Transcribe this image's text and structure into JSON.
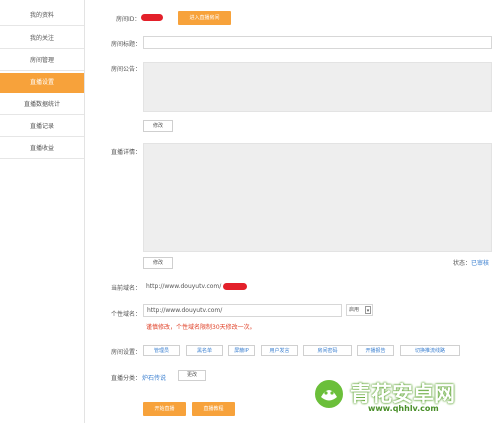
{
  "sidebar": {
    "items": [
      {
        "label": "我的资料"
      },
      {
        "label": "我的关注"
      },
      {
        "label": "房间管理"
      },
      {
        "label": "直播设置",
        "active": true
      },
      {
        "label": "直播数据统计"
      },
      {
        "label": "直播记录"
      },
      {
        "label": "直播收益"
      }
    ]
  },
  "form": {
    "room_id_label": "房间ID：",
    "enter_room_button": "进入直播房间",
    "room_title_label": "房间标题：",
    "room_title_value": "",
    "announcement_label": "房间公告：",
    "announcement_edit": "修改",
    "details_label": "直播详情：",
    "details_edit": "修改",
    "status_label": "状态：",
    "status_value": "已审核",
    "current_domain_label": "当前域名：",
    "current_domain_value": "http://www.douyutv.com/",
    "custom_domain_label": "个性域名：",
    "custom_domain_prefix": "http://www.douyutv.com/",
    "custom_domain_select": "启用",
    "custom_domain_notice": "谨慎修改，个性域名限制30天修改一次。",
    "room_settings_label": "房间设置：",
    "settings_buttons": [
      "管理员",
      "黑名单",
      "屏蔽IP",
      "用户发言",
      "房间密码",
      "开播报告",
      "切换推流线路"
    ],
    "category_label": "直播分类：",
    "category_value": "炉石传说",
    "category_change": "更改",
    "start_live_button": "开始直播",
    "tutorial_button": "直播教程"
  },
  "watermark": {
    "title": "青花安卓网",
    "url": "www.qhhlv.com"
  },
  "colors": {
    "accent": "#f7a23b",
    "link": "#3a7fd0",
    "notice": "#e0432a",
    "redacted": "#e3202a"
  }
}
